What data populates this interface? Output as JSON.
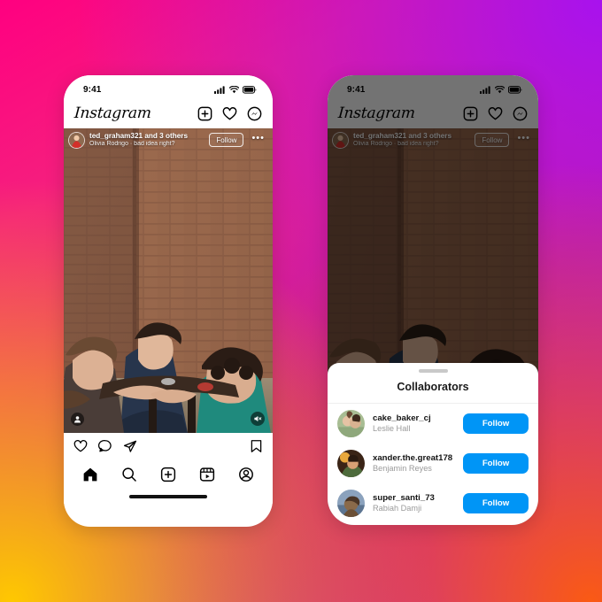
{
  "background": {
    "gradient_colors": [
      "#FF0080",
      "#A812EE",
      "#FFC800",
      "#FA5A14"
    ]
  },
  "accent": {
    "instagram_blue": "#0095F6"
  },
  "phones": {
    "left": {
      "status_bar": {
        "time": "9:41",
        "cellular_icon": "signal-bars-icon",
        "wifi_icon": "wifi-icon",
        "battery_icon": "battery-icon"
      },
      "app_header": {
        "wordmark": "Instagram",
        "icons": [
          "add-post-icon",
          "activity-heart-icon",
          "messenger-icon"
        ]
      },
      "post": {
        "author_title": "ted_graham321 and 3 others",
        "author_subtitle": "Olivia Rodrigo · bad idea right?",
        "follow_label": "Follow",
        "more_label": "•••",
        "tag_icon": "person-tag-icon",
        "mute_icon": "audio-muted-icon"
      },
      "actions": {
        "like_icon": "heart-icon",
        "comment_icon": "comment-bubble-icon",
        "share_icon": "share-paper-plane-icon",
        "save_icon": "bookmark-icon"
      },
      "tab_bar": {
        "home_icon": "home-icon",
        "search_icon": "search-icon",
        "create_icon": "create-plus-icon",
        "reels_icon": "reels-icon",
        "profile_icon": "profile-avatar-icon"
      }
    },
    "right": {
      "status_bar": {
        "time": "9:41",
        "cellular_icon": "signal-bars-icon",
        "wifi_icon": "wifi-icon",
        "battery_icon": "battery-icon"
      },
      "app_header": {
        "wordmark": "Instagram",
        "icons": [
          "add-post-icon",
          "activity-heart-icon",
          "messenger-icon"
        ]
      },
      "post": {
        "author_title": "ted_graham321 and 3 others",
        "author_subtitle": "Olivia Rodrigo · bad idea right?",
        "follow_label": "Follow",
        "more_label": "•••"
      },
      "sheet": {
        "title": "Collaborators",
        "collaborators": [
          {
            "username": "cake_baker_cj",
            "full_name": "Leslie Hall",
            "follow_label": "Follow"
          },
          {
            "username": "xander.the.great178",
            "full_name": "Benjamin Reyes",
            "follow_label": "Follow"
          },
          {
            "username": "super_santi_73",
            "full_name": "Rabiah Damji",
            "follow_label": "Follow"
          }
        ]
      }
    }
  }
}
